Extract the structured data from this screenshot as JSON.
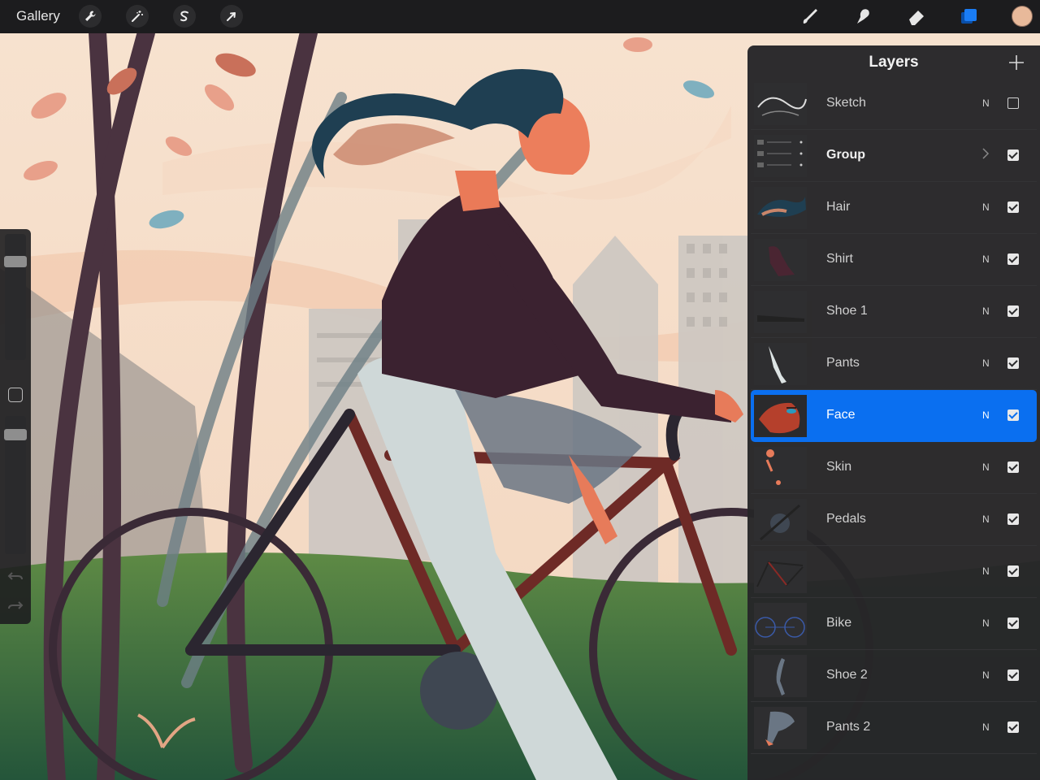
{
  "topbar": {
    "gallery_label": "Gallery",
    "actions": [
      {
        "name": "actions-wrench",
        "icon": "wrench-icon"
      },
      {
        "name": "adjustments",
        "icon": "magic-wand-icon"
      },
      {
        "name": "selection",
        "icon": "selection-s-icon"
      },
      {
        "name": "transform",
        "icon": "arrow-cursor-icon"
      }
    ],
    "tools": [
      {
        "name": "brush",
        "icon": "brush-icon"
      },
      {
        "name": "smudge",
        "icon": "smudge-icon"
      },
      {
        "name": "eraser",
        "icon": "eraser-icon"
      },
      {
        "name": "layers",
        "icon": "layers-icon",
        "active": true
      }
    ],
    "current_color": "#e8b99a"
  },
  "sidebar": {
    "brush_size_level": 0.81,
    "opacity_level": 0.9
  },
  "layers_panel": {
    "title": "Layers",
    "add_icon": "plus-icon",
    "layers": [
      {
        "name": "Sketch",
        "mode": "N",
        "visible": false,
        "selected": false
      },
      {
        "name": "Group",
        "mode": "",
        "visible": true,
        "selected": false,
        "is_group": true
      },
      {
        "name": "Hair",
        "mode": "N",
        "visible": true,
        "selected": false
      },
      {
        "name": "Shirt",
        "mode": "N",
        "visible": true,
        "selected": false
      },
      {
        "name": "Shoe 1",
        "mode": "N",
        "visible": true,
        "selected": false
      },
      {
        "name": "Pants",
        "mode": "N",
        "visible": true,
        "selected": false
      },
      {
        "name": "Face",
        "mode": "N",
        "visible": true,
        "selected": true
      },
      {
        "name": "Skin",
        "mode": "N",
        "visible": true,
        "selected": false
      },
      {
        "name": "Pedals",
        "mode": "N",
        "visible": true,
        "selected": false
      },
      {
        "name": "",
        "mode": "N",
        "visible": true,
        "selected": false
      },
      {
        "name": "Bike",
        "mode": "N",
        "visible": true,
        "selected": false
      },
      {
        "name": "Shoe 2",
        "mode": "N",
        "visible": true,
        "selected": false
      },
      {
        "name": "Pants 2",
        "mode": "N",
        "visible": true,
        "selected": false
      }
    ]
  },
  "colors": {
    "accent": "#0a6ff0",
    "panel_bg": "#262628",
    "toolbar_bg": "#1c1c1e"
  }
}
